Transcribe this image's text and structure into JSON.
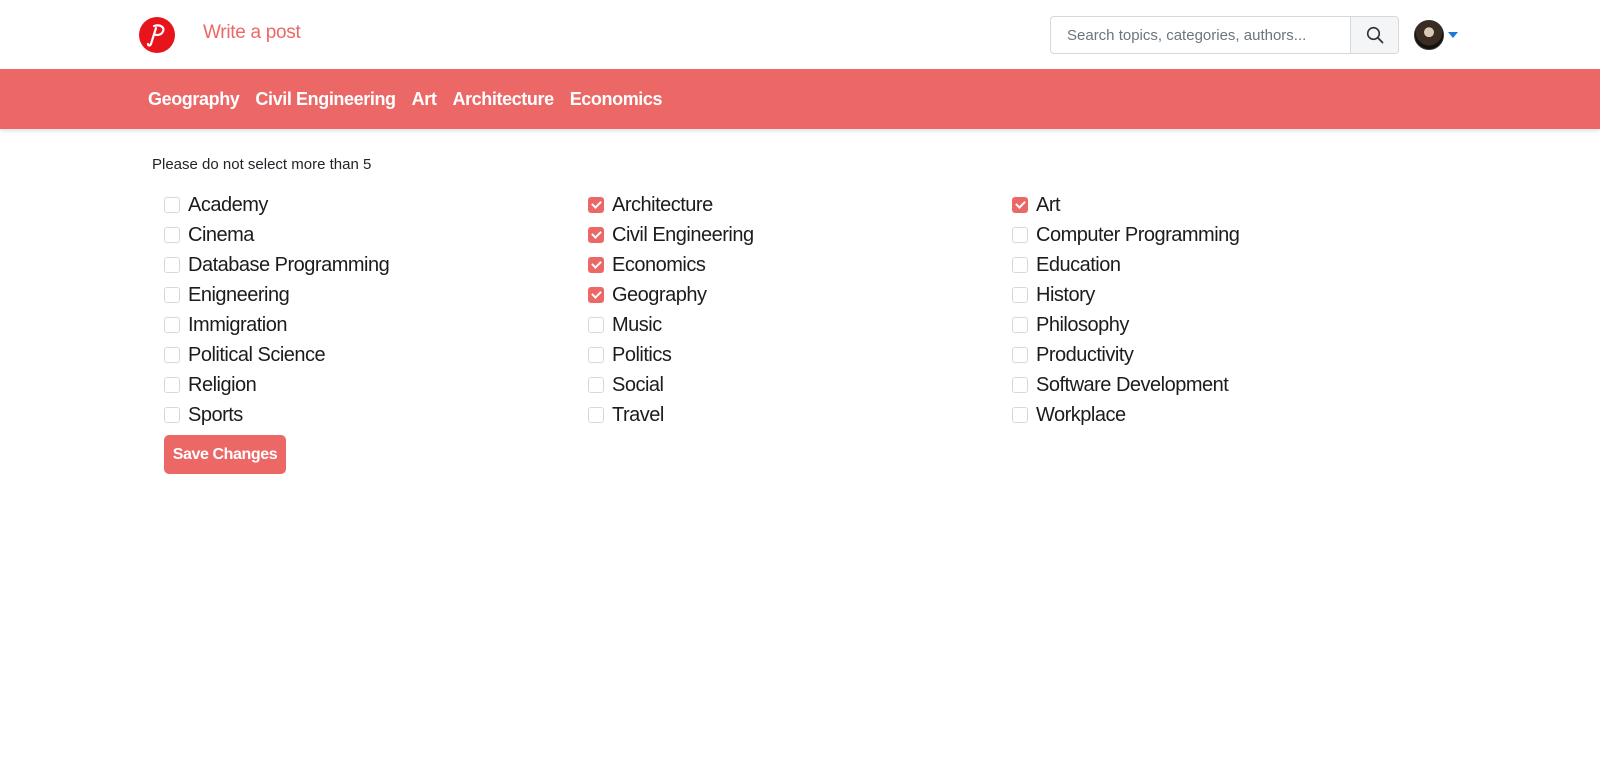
{
  "header": {
    "logo_icon": "pinterest-style-p-logo",
    "write_post": "Write a post",
    "search_placeholder": "Search topics, categories, authors...",
    "search_icon": "search-icon",
    "avatar_icon": "user-avatar",
    "brand_color": "#e8141b",
    "accent_color": "#ec6866"
  },
  "nav": {
    "items": [
      "Geography",
      "Civil Engineering",
      "Art",
      "Architecture",
      "Economics"
    ]
  },
  "main": {
    "notice": "Please do not select more than 5",
    "options": [
      {
        "label": "Academy",
        "checked": false
      },
      {
        "label": "Architecture",
        "checked": true
      },
      {
        "label": "Art",
        "checked": true
      },
      {
        "label": "Cinema",
        "checked": false
      },
      {
        "label": "Civil Engineering",
        "checked": true
      },
      {
        "label": "Computer Programming",
        "checked": false
      },
      {
        "label": "Database Programming",
        "checked": false
      },
      {
        "label": "Economics",
        "checked": true
      },
      {
        "label": "Education",
        "checked": false
      },
      {
        "label": "Enigneering",
        "checked": false
      },
      {
        "label": "Geography",
        "checked": true
      },
      {
        "label": "History",
        "checked": false
      },
      {
        "label": "Immigration",
        "checked": false
      },
      {
        "label": "Music",
        "checked": false
      },
      {
        "label": "Philosophy",
        "checked": false
      },
      {
        "label": "Political Science",
        "checked": false
      },
      {
        "label": "Politics",
        "checked": false
      },
      {
        "label": "Productivity",
        "checked": false
      },
      {
        "label": "Religion",
        "checked": false
      },
      {
        "label": "Social",
        "checked": false
      },
      {
        "label": "Software Development",
        "checked": false
      },
      {
        "label": "Sports",
        "checked": false
      },
      {
        "label": "Travel",
        "checked": false
      },
      {
        "label": "Workplace",
        "checked": false
      }
    ],
    "save_label": "Save Changes"
  }
}
